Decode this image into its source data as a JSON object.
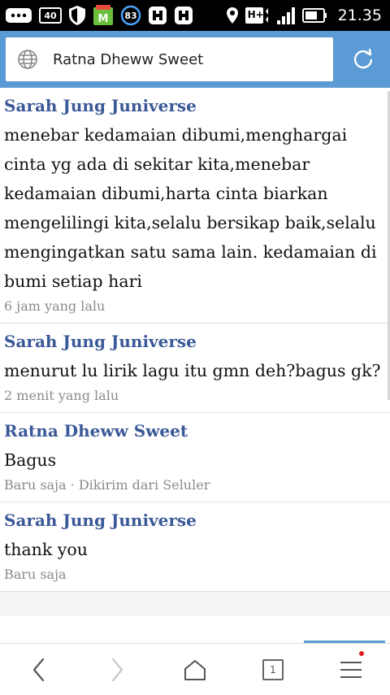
{
  "status_bar": {
    "icons": [
      "message-icon",
      "fm-radio-icon",
      "shield-icon",
      "market-icon",
      "notification-count-icon",
      "sync-icon",
      "sync-icon",
      "location-icon",
      "hplus-signal-icon",
      "signal-bars-icon",
      "battery-icon"
    ],
    "fm_label": "40",
    "notification_count": "83",
    "network_label": "H+",
    "time": "21.35"
  },
  "address_bar": {
    "url": "Ratna Dheww Sweet",
    "accent_color": "#5b9bd5"
  },
  "comments": [
    {
      "author": "Sarah Jung Juniverse",
      "text": "menebar kedamaian dibumi,menghargai cinta yg ada di sekitar kita,menebar kedamaian dibumi,harta cinta biarkan mengelilingi kita,selalu bersikap baik,selalu mengingatkan satu sama lain. kedamaian di bumi setiap hari",
      "time": "6 jam yang lalu"
    },
    {
      "author": "Sarah Jung Juniverse",
      "text": "menurut lu lirik lagu itu gmn deh?bagus gk?",
      "time": "2 menit yang lalu"
    },
    {
      "author": "Ratna Dheww Sweet",
      "text": "Bagus",
      "time": "Baru saja · Dikirim dari Seluler"
    },
    {
      "author": "Sarah Jung Juniverse",
      "text": "thank you",
      "time": "Baru saja"
    }
  ],
  "bottom_nav": {
    "tab_count": "1",
    "link_color": "#3b5998"
  }
}
